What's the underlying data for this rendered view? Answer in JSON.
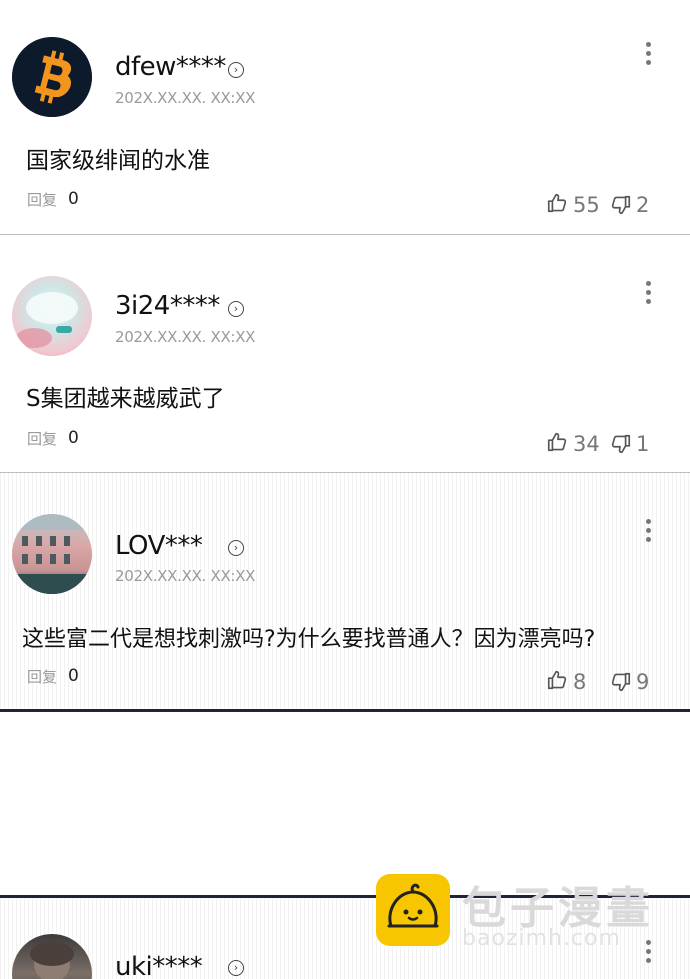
{
  "comments": [
    {
      "username": "dfew****",
      "timestamp": "202X.XX.XX. XX:XX",
      "text": "国家级绯闻的水准",
      "reply_label": "回复",
      "reply_count": "0",
      "likes": "55",
      "dislikes": "2",
      "avatar_icon": "bitcoin-icon"
    },
    {
      "username": "3i24****",
      "timestamp": "202X.XX.XX. XX:XX",
      "text": "S集团越来越威武了",
      "reply_label": "回复",
      "reply_count": "0",
      "likes": "34",
      "dislikes": "1",
      "avatar_icon": "abstract-photo"
    },
    {
      "username": "LOV***",
      "timestamp": "202X.XX.XX. XX:XX",
      "text": "这些富二代是想找刺激吗?为什么要找普通人？因为漂亮吗?",
      "reply_label": "回复",
      "reply_count": "0",
      "likes": "8",
      "dislikes": "9",
      "avatar_icon": "building-photo"
    },
    {
      "username": "uki****",
      "avatar_icon": "person-photo"
    }
  ],
  "watermark": {
    "title": "包子漫畫",
    "subtitle": "baozimh.com"
  },
  "colors": {
    "accent": "#f7c600",
    "divider": "#1f2437"
  }
}
